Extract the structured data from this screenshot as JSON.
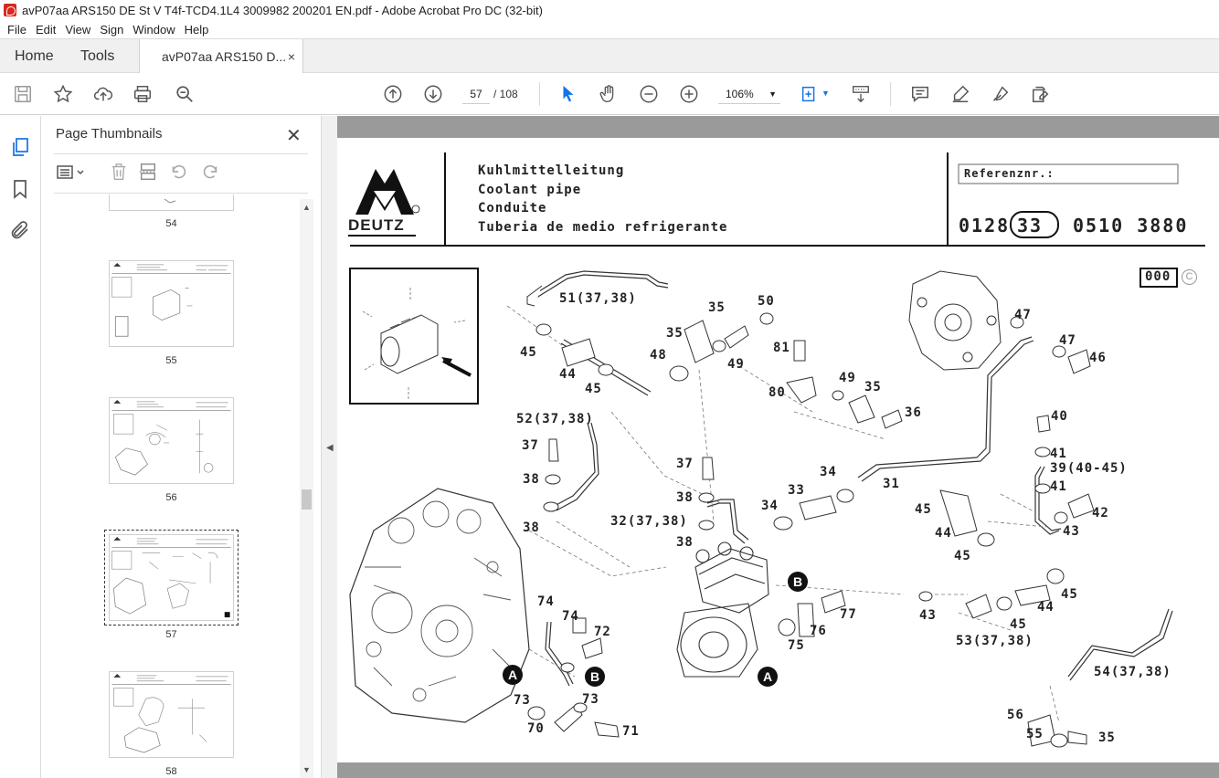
{
  "window": {
    "title": "avP07aa ARS150 DE St V T4f-TCD4.1L4 3009982 200201 EN.pdf - Adobe Acrobat Pro DC (32-bit)"
  },
  "menu": [
    "File",
    "Edit",
    "View",
    "Sign",
    "Window",
    "Help"
  ],
  "tabs": {
    "home": "Home",
    "tools": "Tools",
    "doc": "avP07aa ARS150 D...",
    "close": "×"
  },
  "toolbar": {
    "page_current": "57",
    "page_total": "/ 108",
    "zoom": "106%"
  },
  "thumbnails": {
    "title": "Page Thumbnails",
    "close": "✕",
    "pages": [
      "54",
      "55",
      "56",
      "57",
      "58"
    ],
    "selected": "57"
  },
  "document": {
    "brand": "DEUTZ",
    "titles": [
      "Kuhlmittelleitung",
      "Coolant pipe",
      "Conduite",
      "Tuberia de medio refrigerante"
    ],
    "ref_label": "Referenznr.:",
    "ref_prefix": "0128",
    "ref_circled": "33",
    "ref_suffix": "0510 3880",
    "badge": "000",
    "copyright": "C",
    "labels": [
      "51(37,38)",
      "35",
      "50",
      "45",
      "44",
      "45",
      "48",
      "35",
      "49",
      "81",
      "80",
      "49",
      "35",
      "36",
      "47",
      "47",
      "46",
      "52(37,38)",
      "37",
      "38",
      "38",
      "37",
      "38",
      "32(37,38)",
      "38",
      "34",
      "33",
      "34",
      "31",
      "40",
      "41",
      "39(40-45)",
      "41",
      "42",
      "45",
      "44",
      "45",
      "43",
      "74",
      "74",
      "72",
      "73",
      "70",
      "73",
      "71",
      "77",
      "76",
      "75",
      "43",
      "45",
      "44",
      "45",
      "53(37,38)",
      "54(37,38)",
      "56",
      "55",
      "35"
    ],
    "callouts": [
      "A",
      "B",
      "B",
      "A"
    ]
  }
}
